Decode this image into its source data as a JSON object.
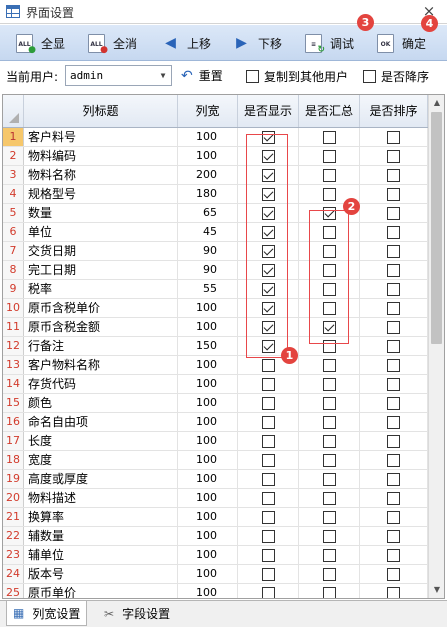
{
  "window": {
    "title": "界面设置",
    "close_glyph": "×"
  },
  "toolbar": {
    "select_all": "全显",
    "clear_all": "全消",
    "move_up": "上移",
    "move_down": "下移",
    "debug": "调试",
    "ok": "确定"
  },
  "user_bar": {
    "current_user_label": "当前用户:",
    "current_user_value": "admin",
    "reset_label": "重置",
    "copy_to_others_label": "复制到其他用户",
    "copy_to_others_checked": false,
    "desc_label": "是否降序",
    "desc_checked": false
  },
  "grid": {
    "columns": [
      "列标题",
      "列宽",
      "是否显示",
      "是否汇总",
      "是否排序"
    ],
    "rows": [
      {
        "idx": "1",
        "name": "客户料号",
        "width": "100",
        "show": true,
        "sum": false,
        "sort": false
      },
      {
        "idx": "2",
        "name": "物料编码",
        "width": "100",
        "show": true,
        "sum": false,
        "sort": false
      },
      {
        "idx": "3",
        "name": "物料名称",
        "width": "200",
        "show": true,
        "sum": false,
        "sort": false
      },
      {
        "idx": "4",
        "name": "规格型号",
        "width": "180",
        "show": true,
        "sum": false,
        "sort": false
      },
      {
        "idx": "5",
        "name": "数量",
        "width": "65",
        "show": true,
        "sum": true,
        "sort": false
      },
      {
        "idx": "6",
        "name": "单位",
        "width": "45",
        "show": true,
        "sum": false,
        "sort": false
      },
      {
        "idx": "7",
        "name": "交货日期",
        "width": "90",
        "show": true,
        "sum": false,
        "sort": false
      },
      {
        "idx": "8",
        "name": "完工日期",
        "width": "90",
        "show": true,
        "sum": false,
        "sort": false
      },
      {
        "idx": "9",
        "name": "税率",
        "width": "55",
        "show": true,
        "sum": false,
        "sort": false
      },
      {
        "idx": "10",
        "name": "原币含税单价",
        "width": "100",
        "show": true,
        "sum": false,
        "sort": false
      },
      {
        "idx": "11",
        "name": "原币含税金额",
        "width": "100",
        "show": true,
        "sum": true,
        "sort": false
      },
      {
        "idx": "12",
        "name": "行备注",
        "width": "150",
        "show": true,
        "sum": false,
        "sort": false
      },
      {
        "idx": "13",
        "name": "客户物料名称",
        "width": "100",
        "show": false,
        "sum": false,
        "sort": false
      },
      {
        "idx": "14",
        "name": "存货代码",
        "width": "100",
        "show": false,
        "sum": false,
        "sort": false
      },
      {
        "idx": "15",
        "name": "颜色",
        "width": "100",
        "show": false,
        "sum": false,
        "sort": false
      },
      {
        "idx": "16",
        "name": "命名自由项",
        "width": "100",
        "show": false,
        "sum": false,
        "sort": false
      },
      {
        "idx": "17",
        "name": "长度",
        "width": "100",
        "show": false,
        "sum": false,
        "sort": false
      },
      {
        "idx": "18",
        "name": "宽度",
        "width": "100",
        "show": false,
        "sum": false,
        "sort": false
      },
      {
        "idx": "19",
        "name": "高度或厚度",
        "width": "100",
        "show": false,
        "sum": false,
        "sort": false
      },
      {
        "idx": "20",
        "name": "物料描述",
        "width": "100",
        "show": false,
        "sum": false,
        "sort": false
      },
      {
        "idx": "21",
        "name": "换算率",
        "width": "100",
        "show": false,
        "sum": false,
        "sort": false
      },
      {
        "idx": "22",
        "name": "辅数量",
        "width": "100",
        "show": false,
        "sum": false,
        "sort": false
      },
      {
        "idx": "23",
        "name": "辅单位",
        "width": "100",
        "show": false,
        "sum": false,
        "sort": false
      },
      {
        "idx": "24",
        "name": "版本号",
        "width": "100",
        "show": false,
        "sum": false,
        "sort": false
      },
      {
        "idx": "25",
        "name": "原币单价",
        "width": "100",
        "show": false,
        "sum": false,
        "sort": false
      }
    ],
    "selected_row_index": 0
  },
  "annotations": {
    "badge1": "1",
    "badge2": "2",
    "badge3": "3",
    "badge4": "4"
  },
  "tabs": {
    "column_width_settings": "列宽设置",
    "field_settings": "字段设置"
  },
  "colors": {
    "toolbar_top": "#dce8f8",
    "highlight": "#e8474a",
    "badge": "#e3443f",
    "row_number": "#d23b2c",
    "selected_row": "#f6c76b"
  }
}
